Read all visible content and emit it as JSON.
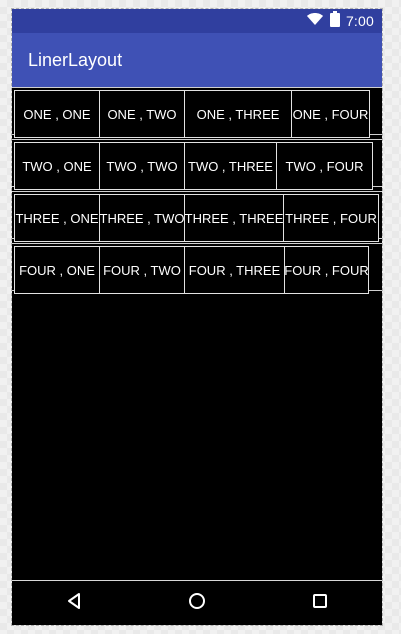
{
  "status_bar": {
    "time": "7:00",
    "wifi_icon": "wifi-icon",
    "battery_icon": "battery-icon"
  },
  "toolbar": {
    "title": "LinerLayout"
  },
  "grid": {
    "rows": [
      {
        "cells": [
          "ONE , ONE",
          "ONE , TWO",
          "ONE , THREE",
          "ONE , FOUR"
        ]
      },
      {
        "cells": [
          "TWO , ONE",
          "TWO , TWO",
          "TWO , THREE",
          "TWO , FOUR"
        ]
      },
      {
        "cells": [
          "THREE , ONE",
          "THREE , TWO",
          "THREE , THREE",
          "THREE , FOUR"
        ]
      },
      {
        "cells": [
          "FOUR , ONE",
          "FOUR , TWO",
          "FOUR , THREE",
          "FOUR , FOUR"
        ]
      }
    ]
  },
  "navigation": {
    "back_icon": "back-icon",
    "home_icon": "home-icon",
    "recents_icon": "recents-icon"
  },
  "colors": {
    "status_bar": "#303f9f",
    "toolbar": "#3f51b5",
    "content_bg": "#000000",
    "text": "#ffffff"
  }
}
